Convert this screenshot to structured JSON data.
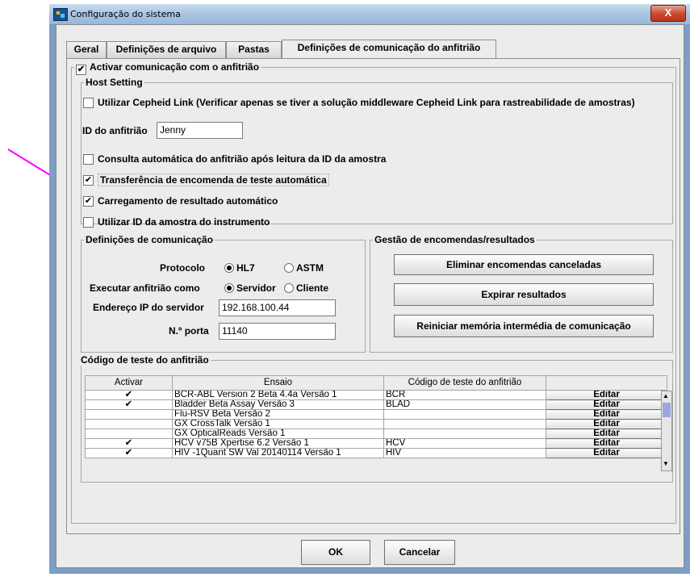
{
  "window": {
    "title": "Configuração do sistema",
    "close_label": "X"
  },
  "tabs": [
    {
      "label": "Geral"
    },
    {
      "label": "Definições de arquivo"
    },
    {
      "label": "Pastas"
    },
    {
      "label": "Definições de comunicação do anfitrião"
    }
  ],
  "enable_comm": {
    "label": "Activar comunicação com o anfitrião",
    "checked": "✔"
  },
  "host_setting": {
    "legend": "Host Setting",
    "cepheid_link": "Utilizar Cepheid Link (Verificar apenas se tiver a solução middleware Cepheid Link para rastreabilidade de amostras)",
    "host_id_label": "ID do anfitrião",
    "host_id_value": "Jenny",
    "auto_query": "Consulta automática do anfitrião após leitura da ID da amostra",
    "auto_order": "Transferência de encomenda de teste automática",
    "auto_result": "Carregamento de resultado automático",
    "use_instrument_id": "Utilizar ID da amostra do instrumento",
    "check_mark": "✔"
  },
  "comm_settings": {
    "legend": "Definições de comunicação",
    "protocol_label": "Protocolo",
    "protocol_hl7": "HL7",
    "protocol_astm": "ASTM",
    "run_as_label": "Executar anfitrião como",
    "run_as_server": "Servidor",
    "run_as_client": "Cliente",
    "ip_label": "Endereço IP do servidor",
    "ip_value": "192.168.100.44",
    "port_label": "N.º porta",
    "port_value": "11140"
  },
  "order_mgmt": {
    "legend": "Gestão de encomendas/resultados",
    "delete_cancelled": "Eliminar encomendas canceladas",
    "expire_results": "Expirar resultados",
    "reset_buffer": "Reiniciar memória intermédia de comunicação"
  },
  "test_codes": {
    "legend": "Código de teste do anfitrião",
    "columns": [
      "Activar",
      "Ensaio",
      "Código de teste do anfitrião",
      ""
    ],
    "edit_label": "Editar",
    "rows": [
      {
        "check": "✔",
        "assay": "BCR-ABL Version 2 Beta 4.4a Versão 1",
        "code": "BCR"
      },
      {
        "check": "✔",
        "assay": "Bladder Beta Assay Versão 3",
        "code": "BLAD"
      },
      {
        "check": "",
        "assay": "Flu-RSV Beta Versão 2",
        "code": ""
      },
      {
        "check": "",
        "assay": "GX CrossTalk Versão 1",
        "code": ""
      },
      {
        "check": "",
        "assay": "GX OpticalReads Versão 1",
        "code": ""
      },
      {
        "check": "✔",
        "assay": "HCV v75B Xpertise 6.2 Versão 1",
        "code": "HCV"
      },
      {
        "check": "✔",
        "assay": "HIV -1Quant SW Val 20140114 Versão 1",
        "code": "HIV"
      }
    ]
  },
  "footer": {
    "ok": "OK",
    "cancel": "Cancelar"
  },
  "colors": {
    "annotation_arrow": "#ff00ff",
    "title_bar": "#a9c4e2",
    "close_button": "#c9472c"
  }
}
